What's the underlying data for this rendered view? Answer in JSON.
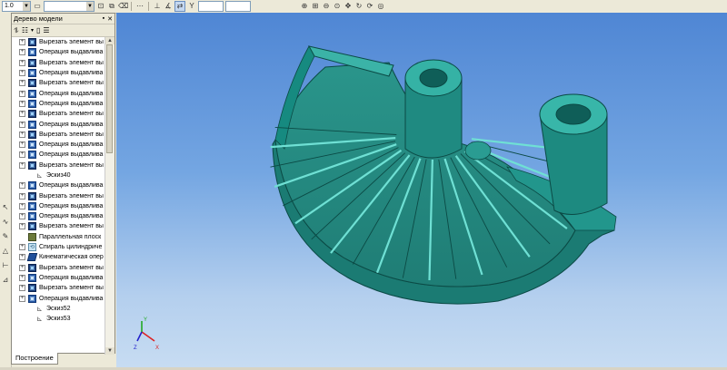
{
  "toolbar": {
    "scale_value": "1.0",
    "icons": [
      "save-icon",
      "grid-icon",
      "layers-icon",
      "eraser-icon",
      "snap-icon",
      "orthogonal-icon",
      "coordinates-icon",
      "zoom-in-icon",
      "zoom-out-icon",
      "zoom-window-icon",
      "pan-icon",
      "rotate-icon",
      "refresh-icon"
    ]
  },
  "tree": {
    "title": "Дерево модели",
    "items": [
      {
        "label": "Вырезать элемент вы",
        "icon": "cut"
      },
      {
        "label": "Операция выдавлива",
        "icon": "extrude"
      },
      {
        "label": "Вырезать элемент вы",
        "icon": "cut"
      },
      {
        "label": "Операция выдавлива",
        "icon": "extrude"
      },
      {
        "label": "Вырезать элемент вы",
        "icon": "cut"
      },
      {
        "label": "Операция выдавлива",
        "icon": "extrude"
      },
      {
        "label": "Операция выдавлива",
        "icon": "extrude"
      },
      {
        "label": "Вырезать элемент вы",
        "icon": "cut"
      },
      {
        "label": "Операция выдавлива",
        "icon": "extrude"
      },
      {
        "label": "Вырезать элемент вы",
        "icon": "cut"
      },
      {
        "label": "Операция выдавлива",
        "icon": "extrude"
      },
      {
        "label": "Операция выдавлива",
        "icon": "extrude"
      },
      {
        "label": "Вырезать элемент вы",
        "icon": "cut"
      },
      {
        "label": "Эскиз40",
        "icon": "sketch"
      },
      {
        "label": "Операция выдавлива",
        "icon": "extrude"
      },
      {
        "label": "Вырезать элемент вы",
        "icon": "cut"
      },
      {
        "label": "Операция выдавлива",
        "icon": "extrude"
      },
      {
        "label": "Операция выдавлива",
        "icon": "extrude"
      },
      {
        "label": "Вырезать элемент вы",
        "icon": "cut"
      },
      {
        "label": "Параллельная плоск",
        "icon": "plane"
      },
      {
        "label": "Спираль цилиндриче",
        "icon": "spiral"
      },
      {
        "label": "Кинематическая опер",
        "icon": "kinematic"
      },
      {
        "label": "Вырезать элемент вы",
        "icon": "cut"
      },
      {
        "label": "Операция выдавлива",
        "icon": "extrude"
      },
      {
        "label": "Вырезать элемент вы",
        "icon": "cut"
      },
      {
        "label": "Операция выдавлива",
        "icon": "extrude"
      },
      {
        "label": "Эскиз52",
        "icon": "sketch"
      },
      {
        "label": "Эскиз53",
        "icon": "sketch"
      }
    ]
  },
  "panel_tab": "Построение",
  "axes": {
    "x": "X",
    "y": "Y",
    "z": "Z"
  },
  "colors": {
    "model_face": "#2f9f94",
    "model_dark": "#17706a",
    "model_light": "#5bd0c4",
    "edge": "#0b4a45",
    "background_top": "#4f86d4",
    "background_bottom": "#c7dcf2"
  }
}
